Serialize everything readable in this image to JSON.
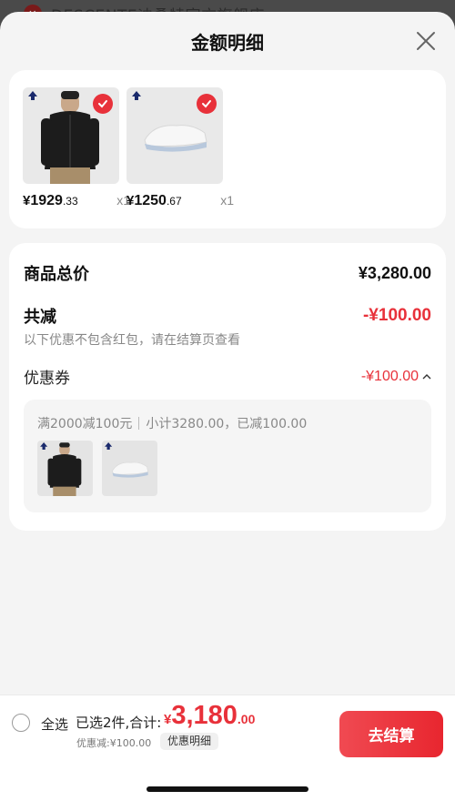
{
  "background_header": {
    "text": "DESCENTE迪桑特官方旗舰店 ›"
  },
  "sheet": {
    "title": "金额明细"
  },
  "products": [
    {
      "name": "black-jacket",
      "price_symbol": "¥",
      "price_int": "1929",
      "price_dec": ".33",
      "qty": "x1"
    },
    {
      "name": "white-sneaker",
      "price_symbol": "¥",
      "price_int": "1250",
      "price_dec": ".67",
      "qty": "x1"
    }
  ],
  "summary": {
    "subtotal_label": "商品总价",
    "subtotal_value": "¥3,280.00",
    "discount_label": "共减",
    "discount_value": "-¥100.00",
    "discount_hint": "以下优惠不包含红包，请在结算页查看",
    "coupon_label": "优惠券",
    "coupon_value": "-¥100.00",
    "coupon_rule": "满2000减100元",
    "coupon_detail": "小计3280.00，已减100.00"
  },
  "bottom_bar": {
    "select_all": "全选",
    "selected_count": "已选2件,合计:",
    "total_symbol": "¥",
    "total_int": "3,180",
    "total_dec": ".00",
    "discount_note": "优惠减:¥100.00",
    "detail_chip": "优惠明细",
    "checkout": "去结算"
  },
  "colors": {
    "accent": "#e8313a",
    "sheet_bg": "#f4f4f4",
    "card_bg": "#ffffff"
  }
}
